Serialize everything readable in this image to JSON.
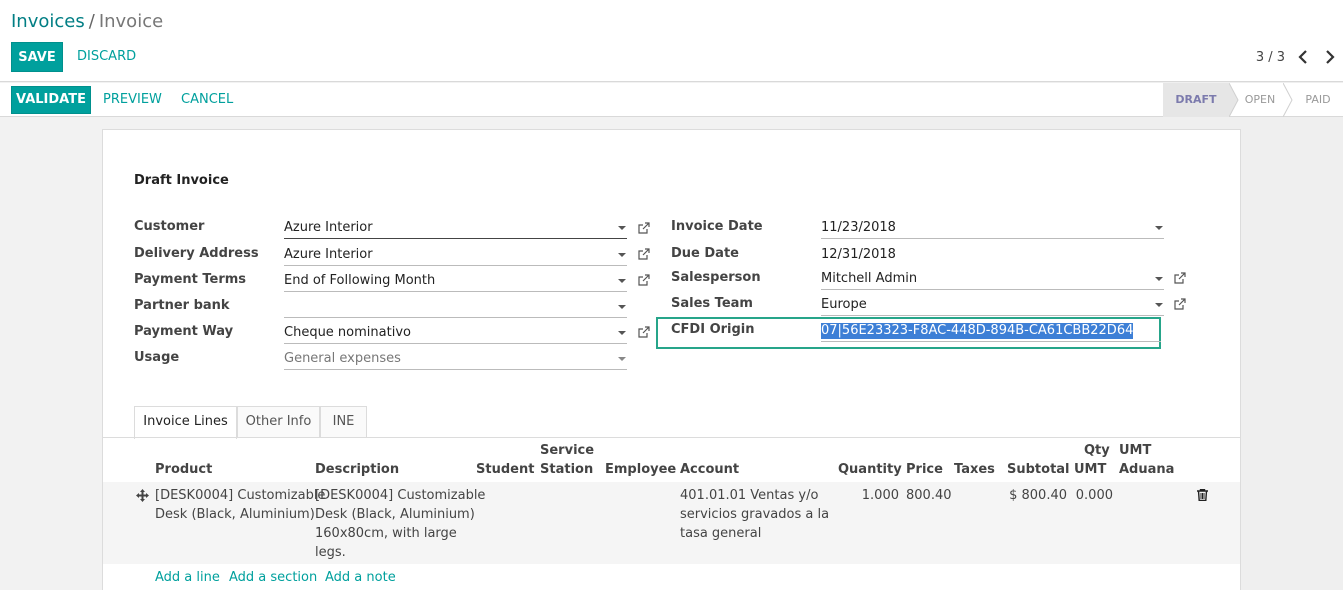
{
  "breadcrumb": {
    "parent": "Invoices",
    "separator": "/",
    "current": "Invoice"
  },
  "control_buttons": {
    "save": "SAVE",
    "discard": "DISCARD"
  },
  "pager": {
    "text": "3 / 3"
  },
  "status_buttons": {
    "validate": "VALIDATE",
    "preview": "PREVIEW",
    "cancel": "CANCEL"
  },
  "stages": [
    {
      "label": "DRAFT",
      "active": true
    },
    {
      "label": "OPEN",
      "active": false
    },
    {
      "label": "PAID",
      "active": false
    }
  ],
  "form": {
    "title": "Draft Invoice",
    "left_fields": [
      {
        "label": "Customer",
        "value": "Azure Interior"
      },
      {
        "label": "Delivery Address",
        "value": "Azure Interior"
      },
      {
        "label": "Payment Terms",
        "value": "End of Following Month"
      },
      {
        "label": "Partner bank",
        "value": ""
      },
      {
        "label": "Payment Way",
        "value": "Cheque nominativo"
      },
      {
        "label": "Usage",
        "value": "General expenses"
      }
    ],
    "right_fields": [
      {
        "label": "Invoice Date",
        "value": "11/23/2018"
      },
      {
        "label": "Due Date",
        "value": "12/31/2018"
      },
      {
        "label": "Salesperson",
        "value": "Mitchell Admin"
      },
      {
        "label": "Sales Team",
        "value": "Europe"
      },
      {
        "label": "CFDI Origin",
        "value": "07|56E23323-F8AC-448D-894B-CA61CBB22D64"
      }
    ]
  },
  "tabs": [
    "Invoice Lines",
    "Other Info",
    "INE"
  ],
  "table": {
    "headers": {
      "product": "Product",
      "description": "Description",
      "student": "Student",
      "service_station_1": "Service",
      "service_station_2": "Station",
      "employee": "Employee",
      "account": "Account",
      "quantity": "Quantity",
      "price": "Price",
      "taxes": "Taxes",
      "subtotal": "Subtotal",
      "qty_umt_1": "Qty",
      "qty_umt_2": "UMT",
      "umt_aduana_1": "UMT",
      "umt_aduana_2": "Aduana"
    },
    "row": {
      "product": [
        "[DESK0004] Customizable",
        "Desk (Black, Aluminium)"
      ],
      "description": [
        "[DESK0004] Customizable",
        "Desk (Black, Aluminium)",
        "160x80cm, with large",
        "legs."
      ],
      "account": [
        "401.01.01 Ventas y/o",
        "servicios gravados a la",
        "tasa general"
      ],
      "quantity": "1.000",
      "price": "800.40",
      "subtotal": "$ 800.40",
      "qty_umt": "0.000"
    },
    "add_links": [
      "Add a line",
      "Add a section",
      "Add a note"
    ]
  },
  "colors": {
    "primary": "#00a09d",
    "highlight_box": "#26a58a",
    "selection": "#3d7fd6"
  },
  "icons": [
    "external-link-icon",
    "chevron-left-icon",
    "chevron-right-icon",
    "drag-handle-icon",
    "trash-icon"
  ]
}
